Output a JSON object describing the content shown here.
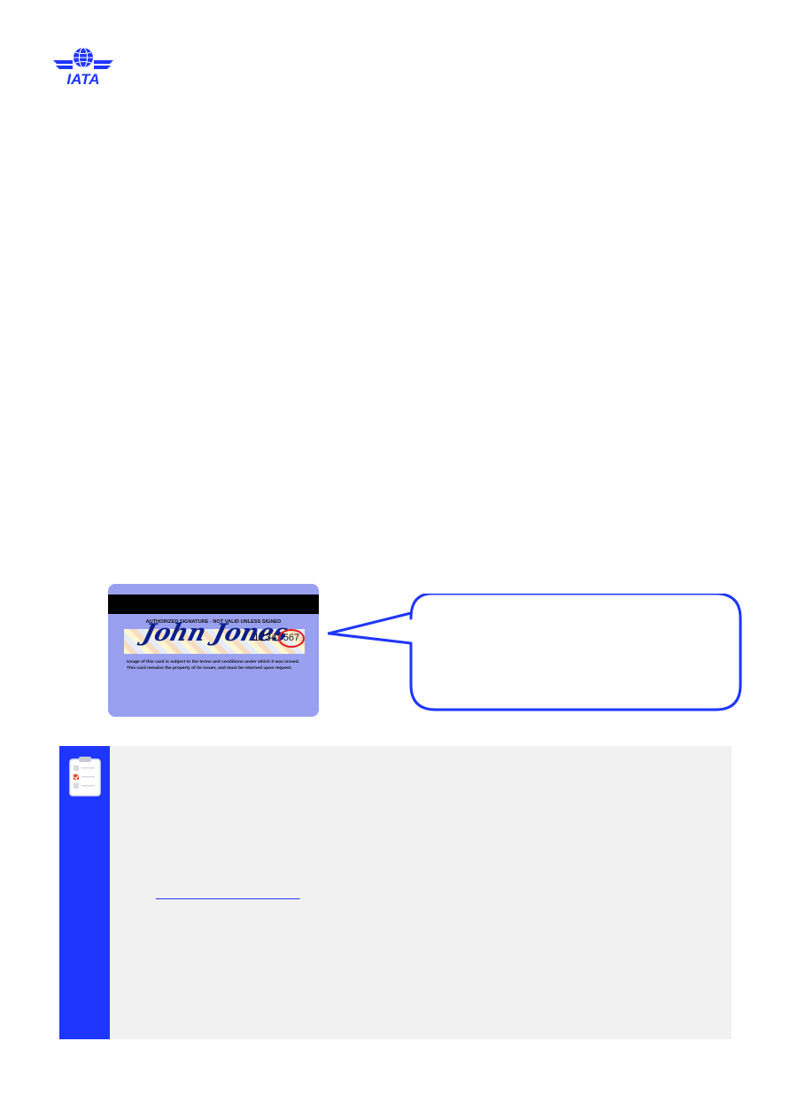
{
  "logo": {
    "text": "IATA"
  },
  "card": {
    "header": "AUTHORIZED SIGNATURE - NOT VALID UNLESS SIGNED",
    "signature": "John Jones",
    "number": "1234",
    "cvv": "567",
    "terms_line1": "Usage of this card is subject to the terms and conditions under which it was issued.",
    "terms_line2": "This card remains the property of its issuer, and must be returned upon request."
  },
  "callout": {
    "text": ""
  },
  "note": {
    "link_text": "                                             "
  },
  "colors": {
    "brand": "#1f36ff",
    "note_bg": "#f1f1f1",
    "card": "#9aa0f0"
  }
}
